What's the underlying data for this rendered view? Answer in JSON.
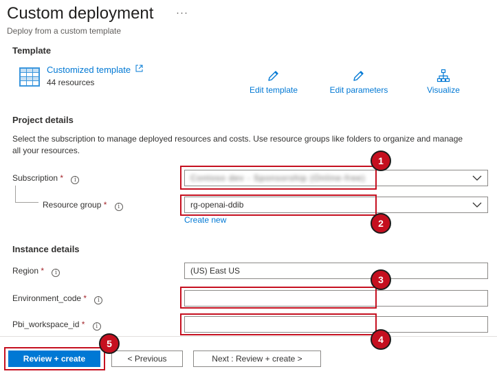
{
  "header": {
    "title": "Custom deployment",
    "more_icon": "···",
    "subtitle": "Deploy from a custom template"
  },
  "template": {
    "section_title": "Template",
    "name": "Customized template",
    "resource_count": "44 resources",
    "actions": [
      {
        "label": "Edit template",
        "icon": "pencil-icon"
      },
      {
        "label": "Edit parameters",
        "icon": "pencil-icon"
      },
      {
        "label": "Visualize",
        "icon": "hierarchy-icon"
      }
    ]
  },
  "project_details": {
    "section_title": "Project details",
    "description": "Select the subscription to manage deployed resources and costs. Use resource groups like folders to organize and manage all your resources.",
    "subscription": {
      "label": "Subscription",
      "value": "Contoso dev - Sponsorship (Online-free)"
    },
    "resource_group": {
      "label": "Resource group",
      "value": "rg-openai-ddib"
    },
    "create_new": "Create new"
  },
  "instance_details": {
    "section_title": "Instance details",
    "region": {
      "label": "Region",
      "value": "(US) East US"
    },
    "environment_code": {
      "label": "Environment_code",
      "value": ""
    },
    "pbi_workspace_id": {
      "label": "Pbi_workspace_id",
      "value": ""
    }
  },
  "required_mark": "*",
  "info_glyph": "i",
  "callouts": [
    "1",
    "2",
    "3",
    "4",
    "5"
  ],
  "footer": {
    "review_create": "Review + create",
    "previous": "< Previous",
    "next": "Next : Review + create >"
  },
  "colors": {
    "accent": "#0078d4",
    "highlight": "#c50f1f",
    "required": "#a4262c"
  }
}
